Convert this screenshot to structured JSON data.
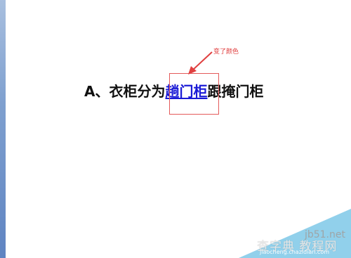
{
  "slide": {
    "text_prefix": "A、衣柜分为",
    "text_highlight": "趟门柜",
    "text_suffix": "跟掩门柜"
  },
  "annotation": {
    "label": "变了颜色",
    "color": "#e04040"
  },
  "watermark": {
    "site": "jb51.net",
    "title": "查字典 教程网",
    "url": "jiaocheng.chazidian.com"
  },
  "colors": {
    "highlight_text": "#1a1ad6",
    "left_panel": "#7fa0cf",
    "corner_triangle": "#7ec8e8"
  }
}
